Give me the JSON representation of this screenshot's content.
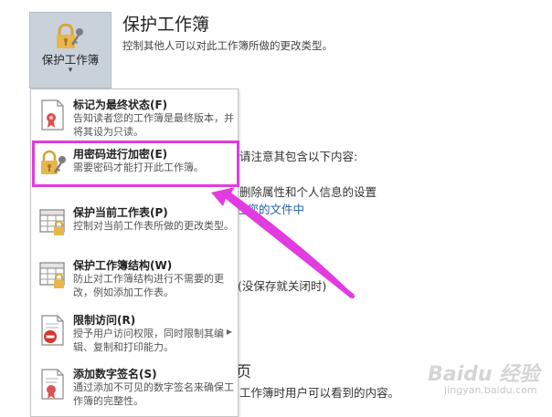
{
  "protect_button": {
    "label": "保护工作簿",
    "caret": "▾"
  },
  "section": {
    "title": "保护工作簿",
    "subtitle": "控制其他人可以对此工作簿所做的更改类型。"
  },
  "background": {
    "line1": "请注意其包含以下内容:",
    "line2": "删除属性和个人信息的设置",
    "line3": "在您的文件中",
    "line4": "(没保存就关闭时)",
    "line5": "页",
    "line6": "工作簿时用户可以看到的内容。"
  },
  "menu": {
    "items": [
      {
        "title": "标记为最终状态(F)",
        "desc": "告知读者您的工作簿是最终版本，并将其设为只读。",
        "icon": "final-document-icon"
      },
      {
        "title": "用密码进行加密(E)",
        "desc": "需要密码才能打开此工作簿。",
        "icon": "lock-key-icon"
      },
      {
        "title": "保护当前工作表(P)",
        "desc": "控制对当前工作表所做的更改类型。",
        "icon": "sheet-lock-icon"
      },
      {
        "title": "保护工作簿结构(W)",
        "desc": "防止对工作簿结构进行不需要的更改，例如添加工作表。",
        "icon": "workbook-structure-lock-icon"
      },
      {
        "title": "限制访问(R)",
        "desc": "授予用户访问权限，同时限制其编辑、复制和打印能力。",
        "icon": "restrict-access-icon"
      },
      {
        "title": "添加数字签名(S)",
        "desc": "通过添加不可见的数字签名来确保工作簿的完整性。",
        "icon": "digital-signature-icon"
      }
    ]
  },
  "watermark": {
    "brand": "Baidu 经验",
    "url": "jingyan.baidu.com"
  },
  "colors": {
    "highlight": "#e23be0",
    "lock_gold": "#e8b64a",
    "button_bg": "#c9d2db"
  }
}
